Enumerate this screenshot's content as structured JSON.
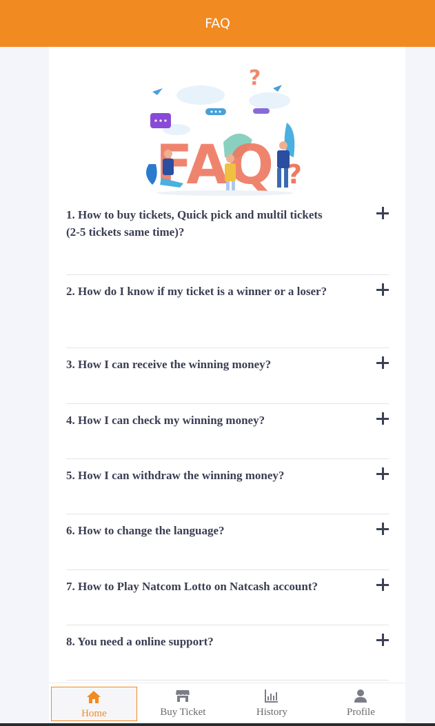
{
  "header": {
    "title": "FAQ"
  },
  "hero": {
    "image_text": "FAQ"
  },
  "faq": [
    {
      "question": "1. How to buy tickets, Quick pick and multil tickets (2-5 tickets same time)?"
    },
    {
      "question": "2. How do I know if my ticket is a winner or a loser?"
    },
    {
      "question": "3. How I can receive the winning money?"
    },
    {
      "question": "4. How I can check my winning money?"
    },
    {
      "question": "5. How I can withdraw the winning money?"
    },
    {
      "question": "6. How to change the language?"
    },
    {
      "question": "7. How to Play Natcom Lotto on Natcash account?"
    },
    {
      "question": "8. You need a online support?"
    }
  ],
  "nav": [
    {
      "label": "Home",
      "icon": "home-icon",
      "active": true
    },
    {
      "label": "Buy Ticket",
      "icon": "store-icon",
      "active": false
    },
    {
      "label": "History",
      "icon": "chart-icon",
      "active": false
    },
    {
      "label": "Profile",
      "icon": "user-icon",
      "active": false
    }
  ],
  "colors": {
    "primary": "#f28a22",
    "text": "#3b3e52",
    "background": "#f4f5fa"
  }
}
